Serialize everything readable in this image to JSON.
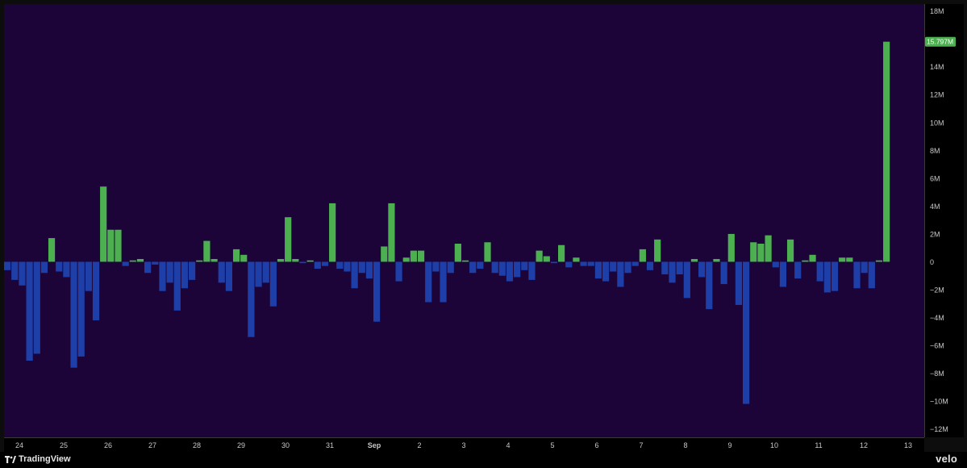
{
  "chart_data": {
    "type": "bar",
    "title": "",
    "xlabel": "",
    "ylabel": "",
    "ylim": [
      -12.6,
      18.5
    ],
    "y_ticks": [
      "18M",
      "16M",
      "14M",
      "12M",
      "10M",
      "8M",
      "6M",
      "4M",
      "2M",
      "0",
      "−2M",
      "−4M",
      "−6M",
      "−8M",
      "−10M",
      "−12M"
    ],
    "x_ticks": [
      "24",
      "25",
      "26",
      "27",
      "28",
      "29",
      "30",
      "31",
      "Sep",
      "2",
      "3",
      "4",
      "5",
      "6",
      "7",
      "8",
      "9",
      "10",
      "11",
      "12",
      "13"
    ],
    "last_value_label": "15.797M",
    "colors": {
      "positive": "#4caf50",
      "negative": "#1e3fa8",
      "background": "#1c0338",
      "label_bg": "#4caf50"
    },
    "grid": false,
    "legend": "none",
    "values_millions": [
      -0.6,
      -1.3,
      -1.7,
      -7.1,
      -6.6,
      -0.8,
      1.7,
      -0.7,
      -1.1,
      -7.6,
      -6.8,
      -2.1,
      -4.2,
      5.4,
      2.3,
      2.3,
      -0.3,
      0.1,
      0.2,
      -0.8,
      -0.2,
      -2.1,
      -1.5,
      -3.5,
      -1.9,
      -1.3,
      0.1,
      1.5,
      0.2,
      -1.5,
      -2.1,
      0.9,
      0.5,
      -5.4,
      -1.8,
      -1.5,
      -3.2,
      0.2,
      3.2,
      0.2,
      -0.1,
      0.1,
      -0.5,
      -0.3,
      4.2,
      -0.5,
      -0.7,
      -1.9,
      -0.8,
      -1.2,
      -4.3,
      1.1,
      4.2,
      -1.4,
      0.3,
      0.8,
      0.8,
      -2.9,
      -0.7,
      -2.9,
      -0.8,
      1.3,
      0.1,
      -0.8,
      -0.5,
      1.4,
      -0.8,
      -1.0,
      -1.4,
      -1.1,
      -0.6,
      -1.3,
      0.8,
      0.4,
      -0.1,
      1.2,
      -0.4,
      0.3,
      -0.3,
      -0.3,
      -1.2,
      -1.4,
      -0.7,
      -1.8,
      -0.8,
      -0.3,
      0.9,
      -0.6,
      1.6,
      -0.9,
      -1.5,
      -0.9,
      -2.6,
      0.2,
      -1.1,
      -3.4,
      0.2,
      -1.6,
      2.0,
      -3.1,
      -10.2,
      1.4,
      1.3,
      1.9,
      -0.4,
      -1.8,
      1.6,
      -1.2,
      0.1,
      0.5,
      -1.4,
      -2.2,
      -2.1,
      0.3,
      0.3,
      -1.9,
      -0.8,
      -1.9,
      0.1,
      15.797
    ]
  }
}
